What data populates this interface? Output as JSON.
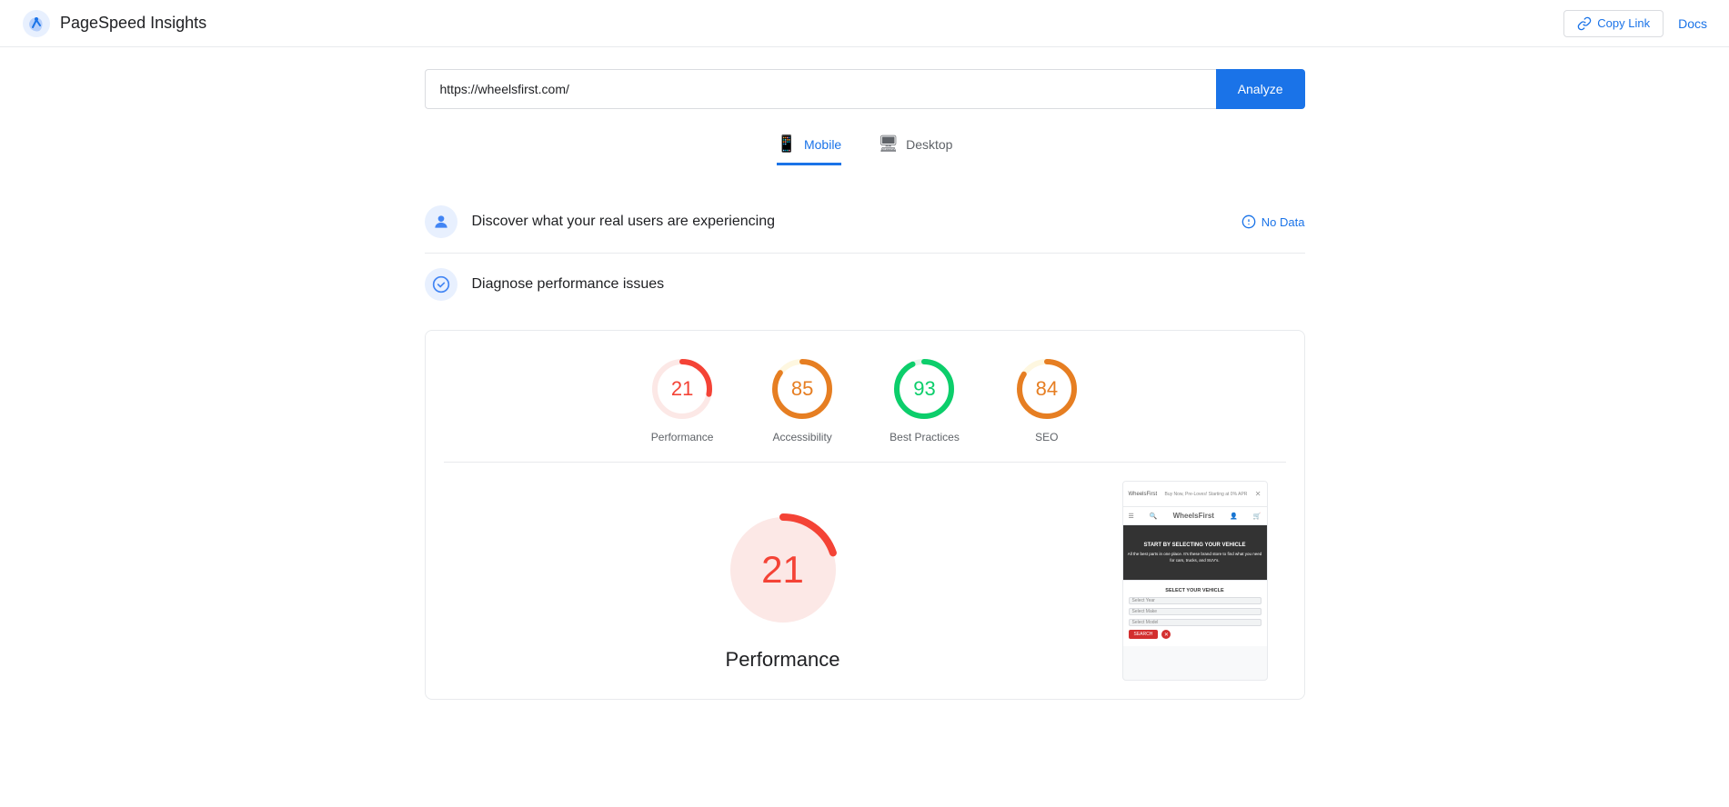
{
  "header": {
    "logo_text": "PageSpeed Insights",
    "copy_link_label": "Copy Link",
    "docs_label": "Docs"
  },
  "search": {
    "url_value": "https://wheelsfirst.com/",
    "analyze_label": "Analyze"
  },
  "tabs": [
    {
      "id": "mobile",
      "label": "Mobile",
      "active": true
    },
    {
      "id": "desktop",
      "label": "Desktop",
      "active": false
    }
  ],
  "real_users_section": {
    "title": "Discover what your real users are experiencing",
    "status": "No Data"
  },
  "diagnose_section": {
    "title": "Diagnose performance issues"
  },
  "scores": [
    {
      "id": "performance",
      "value": 21,
      "label": "Performance",
      "color": "#f44336",
      "track_color": "#fce8e6",
      "stroke_dasharray": "28 100"
    },
    {
      "id": "accessibility",
      "value": 85,
      "label": "Accessibility",
      "color": "#e67e22",
      "track_color": "#fef7e0",
      "stroke_dasharray": "85 100"
    },
    {
      "id": "best-practices",
      "value": 93,
      "label": "Best Practices",
      "color": "#0cce6b",
      "track_color": "#e6f4ea",
      "stroke_dasharray": "93 100"
    },
    {
      "id": "seo",
      "value": 84,
      "label": "SEO",
      "color": "#e67e22",
      "track_color": "#fef7e0",
      "stroke_dasharray": "84 100"
    }
  ],
  "large_score": {
    "value": 21,
    "label": "Performance"
  },
  "preview": {
    "site_name": "WheelsFirst",
    "tagline": "Buy New, Pre-Loved! Starting at 0% APR",
    "hero_text": "START BY SELECTING YOUR VEHICLE\nAll the best parts in one place. It's these brand store to find what you need for cars, trucks, and SUV's.",
    "section_title": "SELECT YOUR VEHICLE",
    "select1": "Select Year",
    "select2": "Select Make",
    "select3": "Select Model",
    "search_btn": "SEARCH"
  }
}
